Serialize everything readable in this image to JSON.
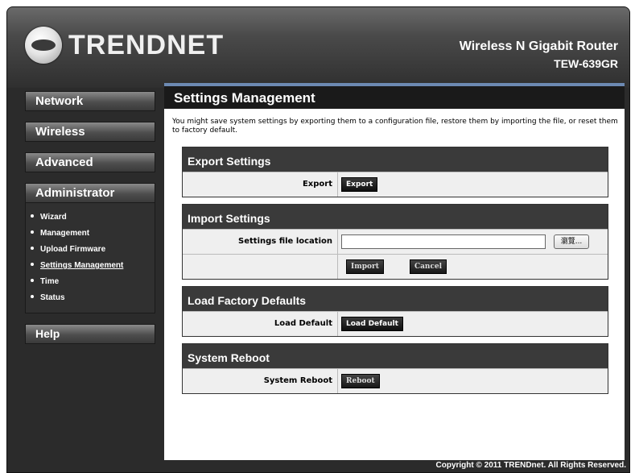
{
  "header": {
    "logo_text": "TRENDNET",
    "product_name": "Wireless N Gigabit Router",
    "model": "TEW-639GR"
  },
  "sidebar": {
    "items": [
      {
        "label": "Network"
      },
      {
        "label": "Wireless"
      },
      {
        "label": "Advanced"
      },
      {
        "label": "Administrator"
      },
      {
        "label": "Help"
      }
    ],
    "admin_submenu": [
      {
        "label": "Wizard"
      },
      {
        "label": "Management"
      },
      {
        "label": "Upload Firmware"
      },
      {
        "label": "Settings Management",
        "active": true
      },
      {
        "label": "Time"
      },
      {
        "label": "Status"
      }
    ]
  },
  "main": {
    "title": "Settings Management",
    "intro": "You might save system settings by exporting them to a configuration file, restore them by importing the file, or reset them to factory default.",
    "export": {
      "heading": "Export Settings",
      "label": "Export",
      "button": "Export"
    },
    "import": {
      "heading": "Import Settings",
      "label": "Settings file location",
      "file_value": "",
      "browse_button": "瀏覽...",
      "import_button": "Import",
      "cancel_button": "Cancel"
    },
    "factory": {
      "heading": "Load Factory Defaults",
      "label": "Load Default",
      "button": "Load Default"
    },
    "reboot": {
      "heading": "System Reboot",
      "label": "System Reboot",
      "button": "Reboot"
    }
  },
  "footer": {
    "copyright": "Copyright © 2011 TRENDnet. All Rights Reserved."
  }
}
